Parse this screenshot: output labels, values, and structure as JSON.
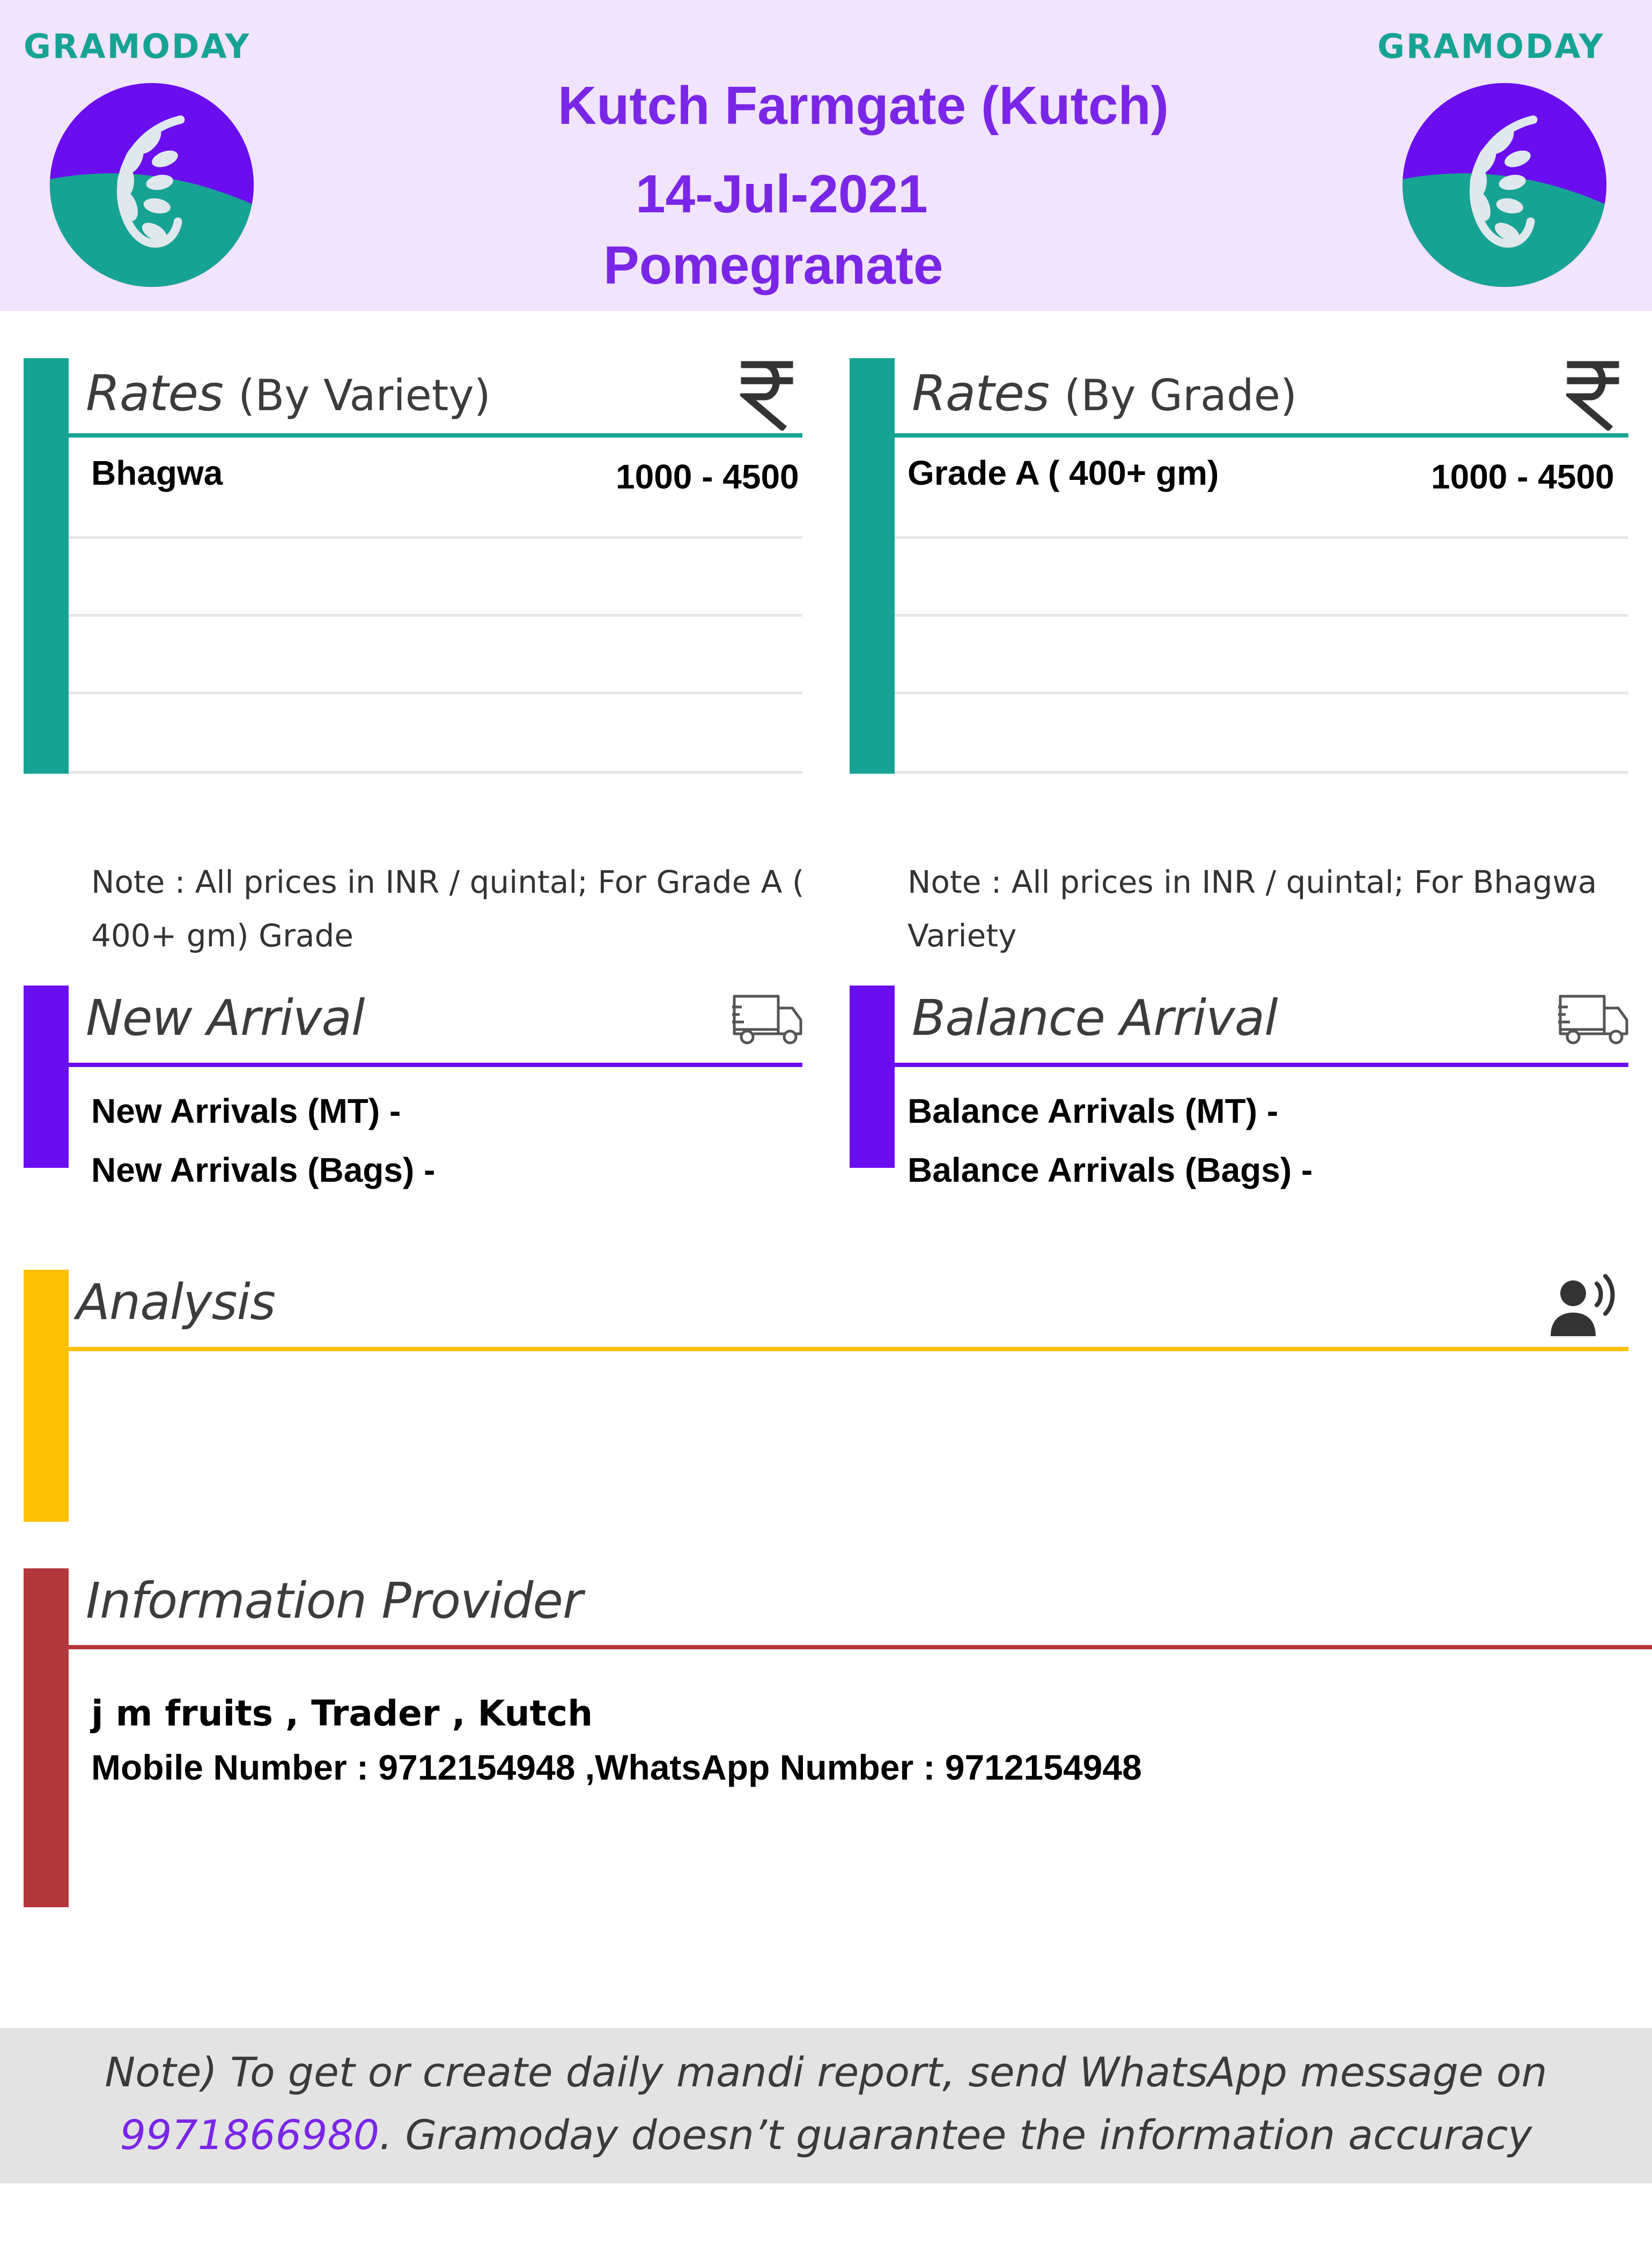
{
  "header": {
    "brand_left": "GRAMODAY",
    "brand_right": "GRAMODAY",
    "market": "Kutch Farmgate (Kutch)",
    "date": "14-Jul-2021",
    "commodity": "Pomegranate"
  },
  "rates_by_variety": {
    "title": "Rates",
    "subtitle": "(By Variety)",
    "icon": "rupee-icon",
    "rows": [
      {
        "name": "Bhagwa",
        "range": "1000 - 4500"
      }
    ],
    "note_line1": "Note : All prices in INR / quintal; For Grade A (",
    "note_line2": "400+ gm) Grade"
  },
  "rates_by_grade": {
    "title": "Rates",
    "subtitle": "(By Grade)",
    "icon": "rupee-icon",
    "rows": [
      {
        "name": "Grade A ( 400+ gm)",
        "range": "1000 - 4500"
      }
    ],
    "note_line1": "Note : All prices in INR / quintal; For Bhagwa",
    "note_line2": "Variety"
  },
  "new_arrival": {
    "title": "New Arrival",
    "icon": "truck-icon",
    "mt_label": "New Arrivals (MT) -",
    "bags_label": "New Arrivals (Bags) -"
  },
  "balance_arrival": {
    "title": "Balance Arrival",
    "icon": "truck-icon",
    "mt_label": "Balance Arrivals (MT) -",
    "bags_label": "Balance Arrivals (Bags) -"
  },
  "analysis": {
    "title": "Analysis",
    "icon": "speaker-person-icon"
  },
  "information_provider": {
    "title": "Information Provider",
    "line1": "j m fruits , Trader , Kutch",
    "line2": "Mobile Number : 9712154948 ,WhatsApp Number : 9712154948"
  },
  "footer": {
    "line1": "Note) To get or create daily mandi report, send WhatsApp message on",
    "phone": "9971866980",
    "line2_rest": ". Gramoday doesn’t guarantee the information accuracy"
  },
  "colors": {
    "header_bg": "#f1e4fd",
    "title_purple": "#7a26e6",
    "teal": "#17a394",
    "violet": "#6a0ef0",
    "amber": "#ffc107",
    "red": "#b3363a"
  }
}
